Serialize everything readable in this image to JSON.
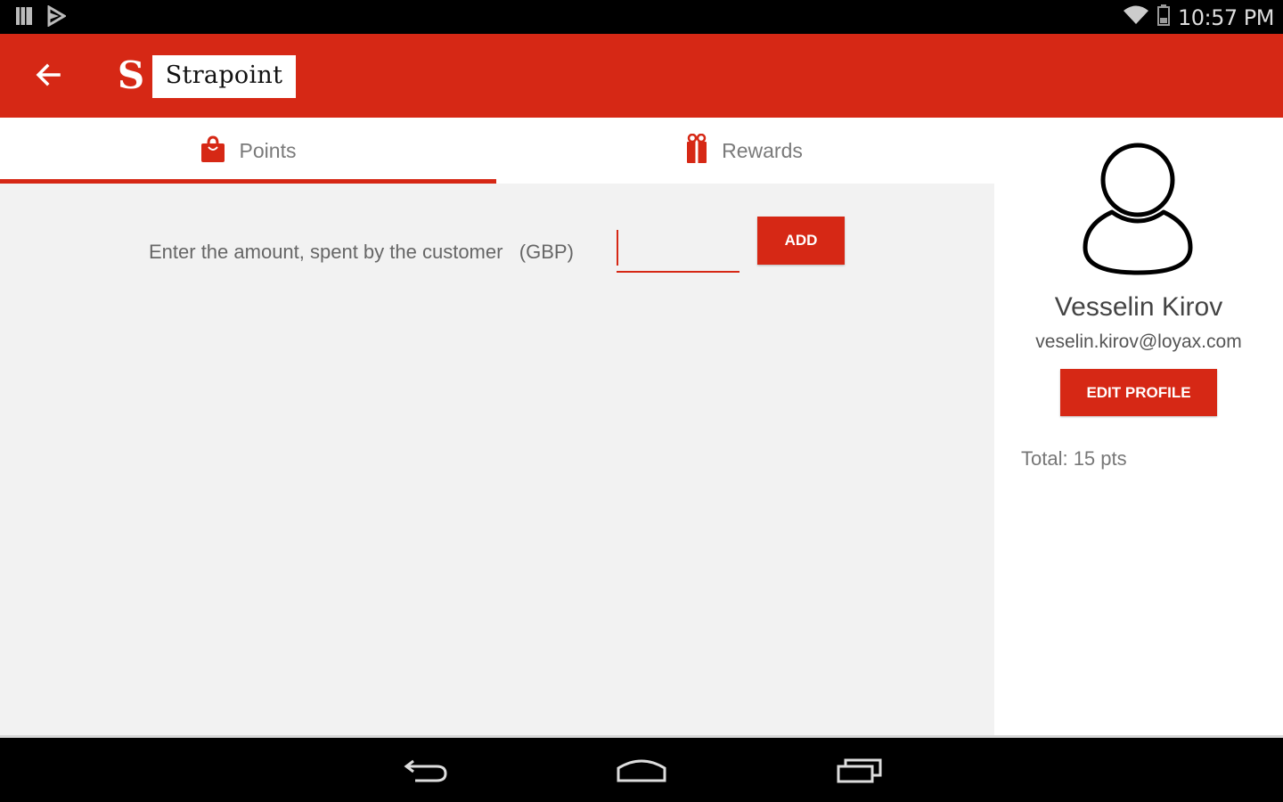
{
  "status_bar": {
    "time": "10:57 PM",
    "left_icons": [
      "notification-icon",
      "play-store-icon"
    ],
    "right_icons": [
      "wifi-icon",
      "battery-icon"
    ]
  },
  "app_bar": {
    "logo_letter": "S",
    "logo_text": "Strapoint",
    "back_icon": "arrow-left-icon"
  },
  "tabs": [
    {
      "label": "Points",
      "icon": "shopping-bag-icon",
      "selected": true
    },
    {
      "label": "Rewards",
      "icon": "gift-icon",
      "selected": false
    }
  ],
  "points_form": {
    "label": "Enter the amount, spent by the customer",
    "currency": "(GBP)",
    "input_value": "",
    "add_button": "ADD"
  },
  "profile": {
    "name": "Vesselin Kirov",
    "email": "veselin.kirov@loyax.com",
    "edit_button": "EDIT PROFILE",
    "total": "Total: 15 pts"
  },
  "nav_bar": {
    "buttons": [
      "back-nav-icon",
      "home-nav-icon",
      "recents-nav-icon"
    ]
  },
  "colors": {
    "brand_red": "#d62815",
    "content_bg": "#f2f2f2"
  }
}
